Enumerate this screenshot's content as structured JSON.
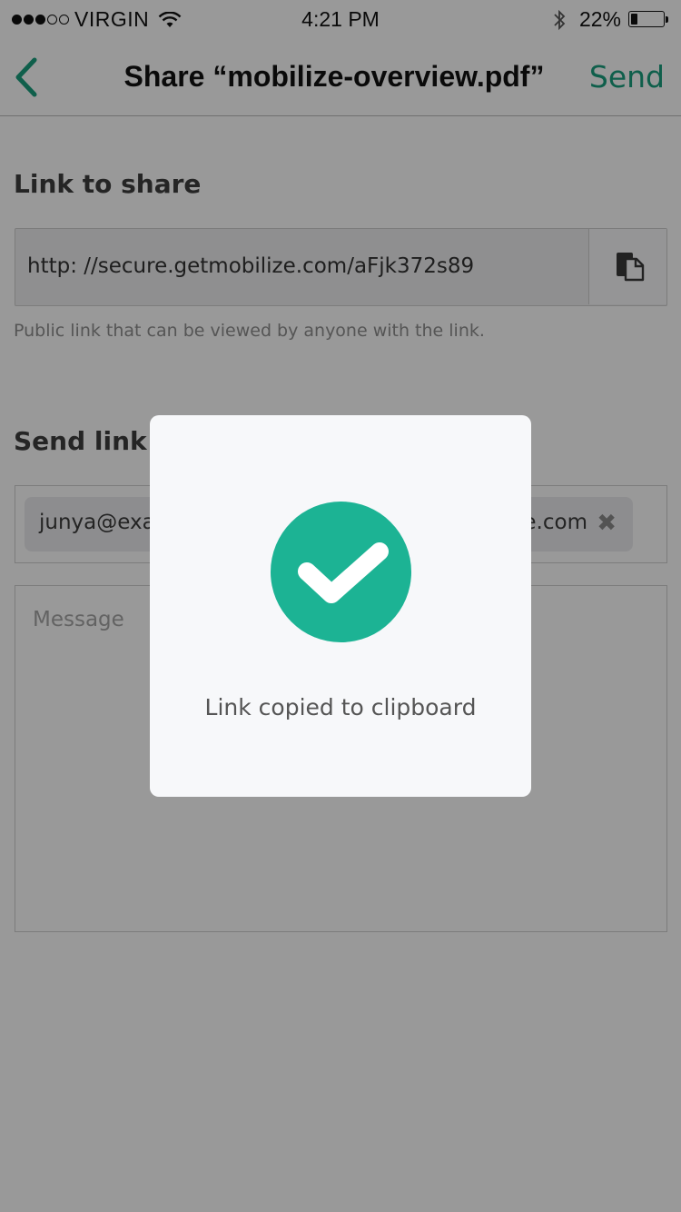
{
  "status_bar": {
    "carrier": "VIRGIN",
    "signal_bars_filled": 3,
    "signal_bars_total": 5,
    "time": "4:21 PM",
    "battery_percent": "22%",
    "battery_level": 0.22
  },
  "nav": {
    "title": "Share “mobilize-overview.pdf”",
    "send_label": "Send",
    "accent_color": "#1a9e7e"
  },
  "share_link": {
    "section_label": "Link to share",
    "url": "http: //secure.getmobilize.com/aFjk372s89",
    "hint": "Public link that can be viewed by anyone with the link."
  },
  "send_link": {
    "section_label": "Send link t",
    "recipient_visible_left": "junya@exa",
    "recipient_visible_right": "e.com",
    "message_placeholder": "Message"
  },
  "toast": {
    "message": "Link copied to clipboard",
    "icon": "checkmark-icon",
    "badge_color": "#1cb394"
  }
}
